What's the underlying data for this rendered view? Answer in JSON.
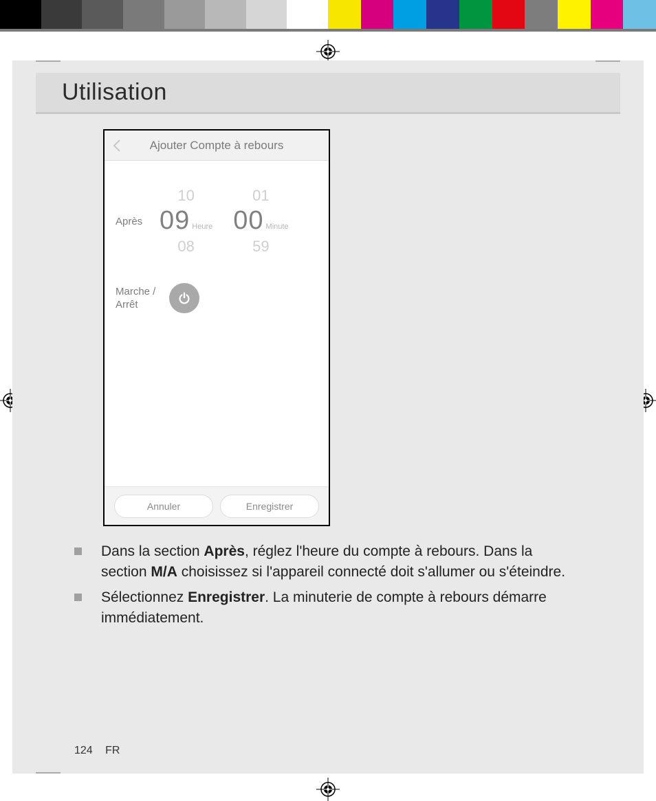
{
  "calibration": {
    "left_swatches": [
      "#000000",
      "#3a3a3a",
      "#5a5a5a",
      "#7a7a7a",
      "#9a9a9a",
      "#b8b8b8",
      "#d6d6d6",
      "#ffffff"
    ],
    "right_swatches": [
      "#f6e600",
      "#d6007e",
      "#009fe3",
      "#27348b",
      "#009640",
      "#e30613",
      "#7d7d7d",
      "#fff200",
      "#e6007e",
      "#6ec1e4"
    ]
  },
  "header": {
    "title": "Utilisation"
  },
  "phone": {
    "title": "Ajouter Compte à rebours",
    "after_label": "Après",
    "hour_prev": "10",
    "hour_selected": "09",
    "hour_next": "08",
    "hour_unit": "Heure",
    "minute_prev": "01",
    "minute_selected": "00",
    "minute_next": "59",
    "minute_unit": "Minute",
    "toggle_label": "Marche / Arrêt",
    "cancel": "Annuler",
    "save": "Enregistrer"
  },
  "body": {
    "p1_a": "Dans la section ",
    "p1_b": "Après",
    "p1_c": ", réglez l'heure du compte à rebours. Dans la section ",
    "p1_d": "M/A",
    "p1_e": " choisissez si l'appareil connecté doit s'allumer ou s'éteindre.",
    "p2_a": "Sélectionnez ",
    "p2_b": "Enregistrer",
    "p2_c": ". La minuterie de compte à rebours démarre immédiatement."
  },
  "footer": {
    "page_number": "124",
    "lang": "FR"
  }
}
